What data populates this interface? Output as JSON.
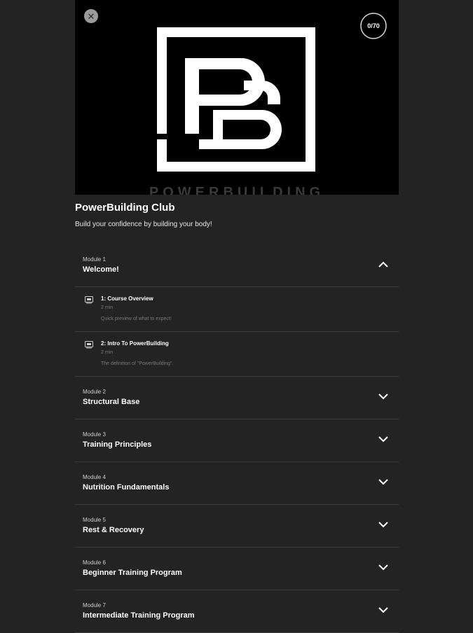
{
  "course": {
    "title": "PowerBuilding Club",
    "subtitle": "Build your confidence by building your body!",
    "progress": "0/70",
    "hero_tagline": "POWERBUILDING"
  },
  "icons": {
    "close": "close-icon",
    "chevron_up": "chevron-up-icon",
    "chevron_down": "chevron-down-icon",
    "lesson": "lesson-icon"
  },
  "modules": [
    {
      "number": "Module 1",
      "name": "Welcome!",
      "expanded": true,
      "lessons": [
        {
          "title": "1: Course Overview",
          "duration": "2 min",
          "description": "Quick preview of what to expect!"
        },
        {
          "title": "2: Intro To PowerBuilding",
          "duration": "2 min",
          "description": "The definition of \"PowerBuilding\"."
        }
      ]
    },
    {
      "number": "Module 2",
      "name": "Structural Base",
      "expanded": false
    },
    {
      "number": "Module 3",
      "name": "Training Principles",
      "expanded": false
    },
    {
      "number": "Module 4",
      "name": "Nutrition Fundamentals",
      "expanded": false
    },
    {
      "number": "Module 5",
      "name": "Rest & Recovery",
      "expanded": false
    },
    {
      "number": "Module 6",
      "name": "Beginner Training Program",
      "expanded": false
    },
    {
      "number": "Module 7",
      "name": "Intermediate Training Program",
      "expanded": false
    }
  ]
}
